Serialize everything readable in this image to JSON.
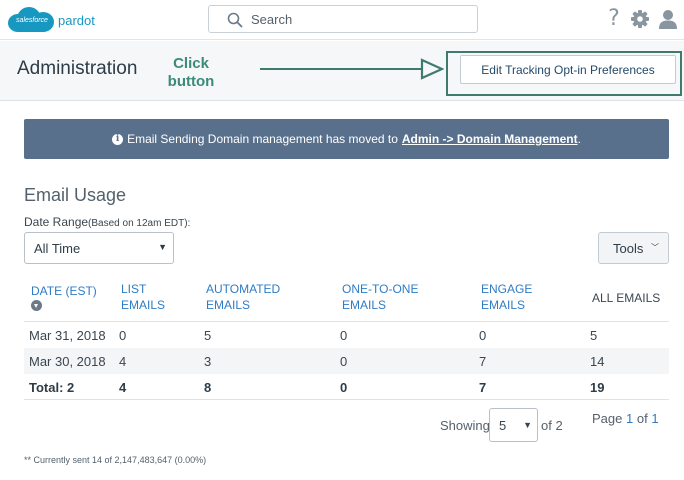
{
  "topbar": {
    "logo_cloud_text": "salesforce",
    "logo_product": "pardot",
    "search_placeholder": "Search",
    "icons": [
      "search-icon",
      "help-icon",
      "gear-icon",
      "user-icon"
    ]
  },
  "header": {
    "title": "Administration",
    "note_line1": "Click",
    "note_line2": "button",
    "edit_button_label": "Edit Tracking Opt-in Preferences"
  },
  "banner": {
    "text": "Email Sending Domain management has moved to",
    "link_text": "Admin -> Domain Management",
    "suffix": "."
  },
  "usage": {
    "title": "Email Usage",
    "date_range_label": "Date Range",
    "date_range_hint": "(Based on 12am EDT):",
    "date_range_value": "All Time",
    "tools_label": "Tools"
  },
  "table": {
    "headers": [
      {
        "line1": "DATE (EST)",
        "line2": ""
      },
      {
        "line1": "LIST",
        "line2": "EMAILS"
      },
      {
        "line1": "AUTOMATED",
        "line2": "EMAILS"
      },
      {
        "line1": "ONE-TO-ONE",
        "line2": "EMAILS"
      },
      {
        "line1": "ENGAGE",
        "line2": "EMAILS"
      },
      {
        "line1": "ALL EMAILS",
        "line2": ""
      }
    ],
    "rows": [
      [
        "Mar 31, 2018",
        "0",
        "5",
        "0",
        "0",
        "5"
      ],
      [
        "Mar 30, 2018",
        "4",
        "3",
        "0",
        "7",
        "14"
      ]
    ],
    "total": [
      "Total: 2",
      "4",
      "8",
      "0",
      "7",
      "19"
    ]
  },
  "pagination": {
    "showing_label": "Showing",
    "page_size": "5",
    "of_total": "of 2",
    "page_label": "Page",
    "current_page": "1",
    "of_label": "of",
    "total_pages": "1"
  },
  "footnote": "** Currently sent 14 of 2,147,483,647 (0.00%)",
  "colors": {
    "accent": "#1798c1",
    "banner": "#59708c",
    "link": "#2f7cc4",
    "highlight": "#3f7a6a"
  }
}
